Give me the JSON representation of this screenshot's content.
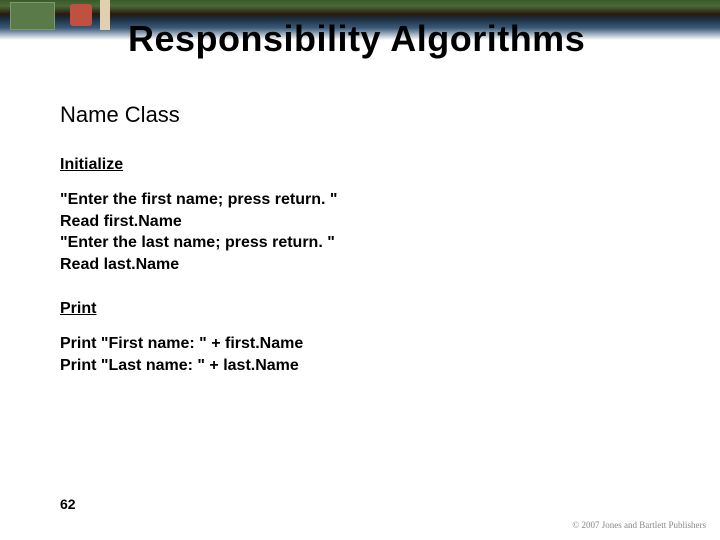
{
  "title": "Responsibility Algorithms",
  "subtitle": "Name Class",
  "sections": {
    "init": {
      "heading": "Initialize",
      "lines": [
        "\"Enter the first name; press return. \"",
        "Read first.Name",
        "\"Enter the last name; press return. \"",
        "Read last.Name"
      ]
    },
    "print": {
      "heading": "Print",
      "lines": [
        "Print \"First name: \" + first.Name",
        "Print \"Last name: \" + last.Name"
      ]
    }
  },
  "page_number": "62",
  "copyright": "© 2007 Jones and Bartlett Publishers"
}
